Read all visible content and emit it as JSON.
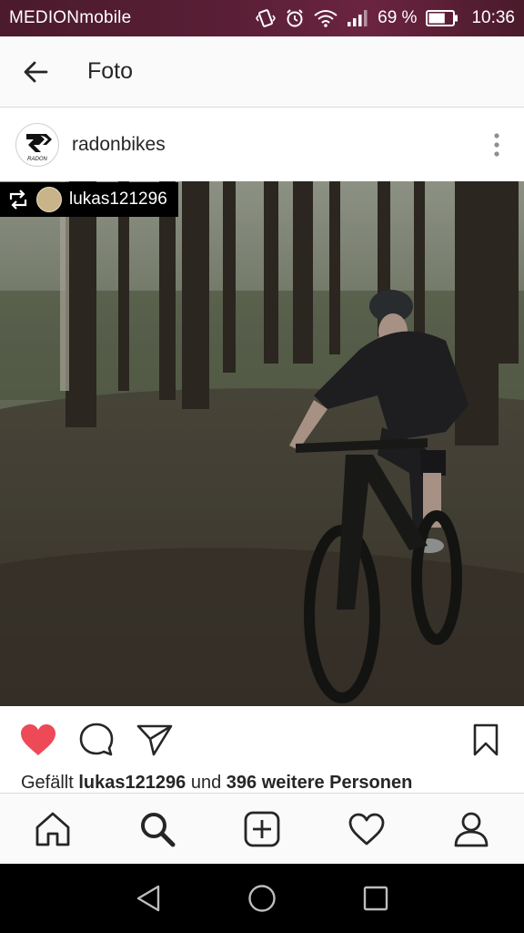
{
  "status_bar": {
    "carrier": "MEDIONmobile",
    "battery_percent": "69 %",
    "battery_level": 0.69,
    "time": "10:36",
    "icons": [
      "vibrate-icon",
      "alarm-icon",
      "wifi-icon",
      "signal-icon",
      "battery-icon"
    ]
  },
  "app_bar": {
    "title": "Foto",
    "back_icon": "arrow-left-icon"
  },
  "post": {
    "username": "radonbikes",
    "avatar_text": "RADON",
    "repost": {
      "username": "lukas121296",
      "icon": "repost-icon"
    },
    "likes": {
      "prefix": "Gefällt",
      "user": "lukas121296",
      "middle": "und",
      "count_text": "396 weitere Personen"
    },
    "liked": true,
    "colors": {
      "like": "#ed4956"
    }
  },
  "bottom_nav": [
    "home-icon",
    "search-icon",
    "add-post-icon",
    "activity-heart-icon",
    "profile-icon"
  ],
  "system_nav": [
    "back-triangle-icon",
    "home-circle-icon",
    "recents-square-icon"
  ]
}
